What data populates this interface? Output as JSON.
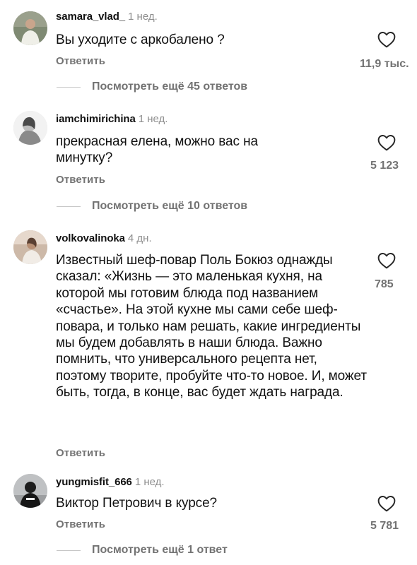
{
  "comments": [
    {
      "username": "samara_vlad_",
      "time": "1 нед.",
      "text": "Вы уходите с аркобалено ?",
      "reply_label": "Ответить",
      "likes": "11,9 тыс.",
      "more_replies": "Посмотреть ещё 45 ответов"
    },
    {
      "username": "iamchimirichina",
      "time": "1 нед.",
      "text": "прекрасная елена, можно вас на минутку?",
      "reply_label": "Ответить",
      "likes": "5 123",
      "more_replies": "Посмотреть ещё 10 ответов"
    },
    {
      "username": "volkovalinoka",
      "time": "4 дн.",
      "text": "Известный шеф-повар Поль Бокюз однажды сказал: «Жизнь — это маленькая кухня, на которой мы готовим блюда под названием «счастье». На этой кухне мы сами себе шеф-повара, и только нам решать, какие ингредиенты мы будем добавлять в наши блюда. Важно помнить, что универсального рецепта нет, поэтому творите, пробуйте что-то новое. И, может быть, тогда, в конце, вас будет ждать награда.",
      "reply_label": "Ответить",
      "likes": "785"
    },
    {
      "username": "yungmisfit_666",
      "time": "1 нед.",
      "text": "Виктор Петрович в курсе?",
      "reply_label": "Ответить",
      "likes": "5 781",
      "more_replies": "Посмотреть ещё 1 ответ"
    }
  ]
}
